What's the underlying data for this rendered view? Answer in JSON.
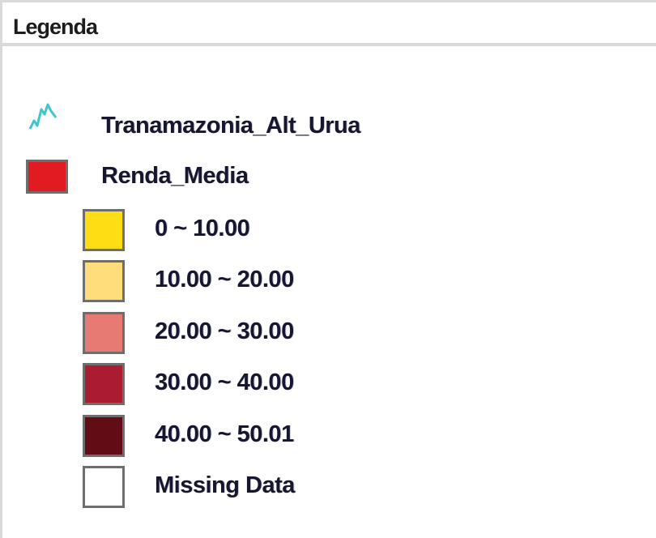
{
  "window": {
    "title": "Legenda"
  },
  "layers": [
    {
      "name": "Tranamazonia_Alt_Urua",
      "icon": "line-layer-icon",
      "color": "#3ec7c9"
    },
    {
      "name": "Renda_Media",
      "icon": "polygon-layer-icon",
      "color": "#e21b23"
    }
  ],
  "classes": [
    {
      "label": "0 ~ 10.00",
      "color": "#ffdd14"
    },
    {
      "label": "10.00 ~ 20.00",
      "color": "#ffdd7a"
    },
    {
      "label": "20.00 ~ 30.00",
      "color": "#e77a72"
    },
    {
      "label": "30.00 ~ 40.00",
      "color": "#ac1c31"
    },
    {
      "label": "40.00 ~ 50.01",
      "color": "#620d15"
    },
    {
      "label": "Missing Data",
      "color": "#ffffff"
    }
  ]
}
